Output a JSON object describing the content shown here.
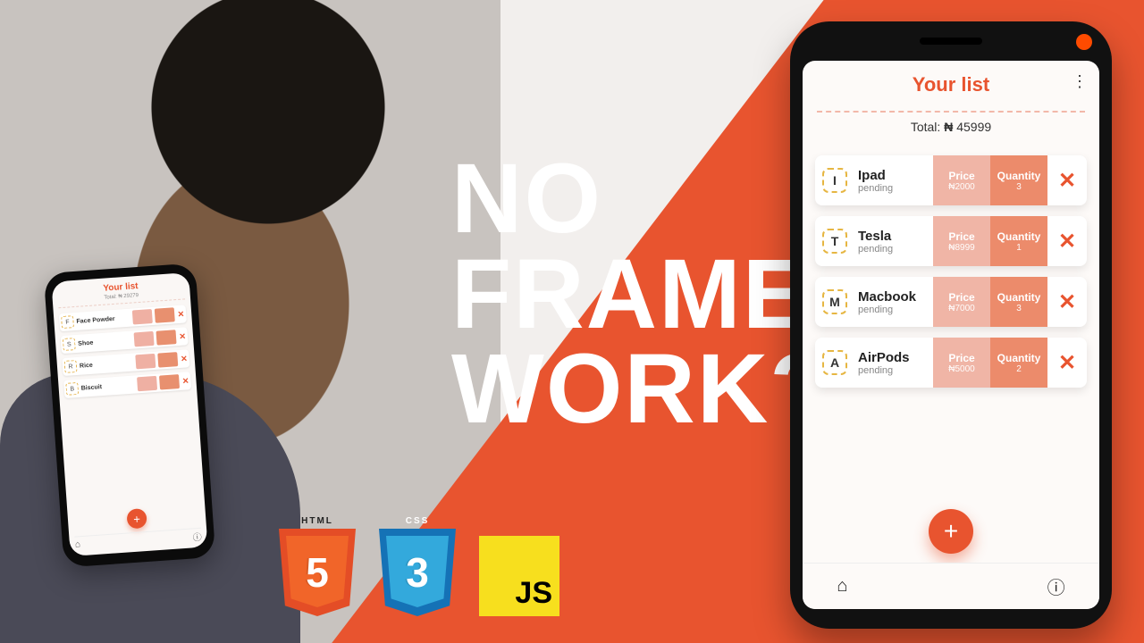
{
  "headline": {
    "line1": "NO",
    "line2": "FRAME",
    "line3": "WORK?"
  },
  "badges": {
    "html": {
      "top": "HTML",
      "num": "5"
    },
    "css": {
      "top": "CSS",
      "num": "3"
    },
    "js": {
      "label": "JS"
    }
  },
  "held_phone": {
    "title": "Your list",
    "subtitle": "Total: ₦ 29279",
    "rows": [
      {
        "initial": "F",
        "name": "Face Powder"
      },
      {
        "initial": "S",
        "name": "Shoe"
      },
      {
        "initial": "R",
        "name": "Rice"
      },
      {
        "initial": "B",
        "name": "Biscuit"
      }
    ],
    "fab": "+"
  },
  "app": {
    "title": "Your list",
    "total_label": "Total:",
    "currency": "₦",
    "total_value": "45999",
    "price_label": "Price",
    "qty_label": "Quantity",
    "status_label": "pending",
    "items": [
      {
        "initial": "I",
        "name": "Ipad",
        "price": "₦2000",
        "qty": "3"
      },
      {
        "initial": "T",
        "name": "Tesla",
        "price": "₦8999",
        "qty": "1"
      },
      {
        "initial": "M",
        "name": "Macbook",
        "price": "₦7000",
        "qty": "3"
      },
      {
        "initial": "A",
        "name": "AirPods",
        "price": "₦5000",
        "qty": "2"
      }
    ],
    "fab": "+",
    "kebab": "⋮",
    "nav": {
      "home": "⌂",
      "info": "ⓘ"
    }
  }
}
